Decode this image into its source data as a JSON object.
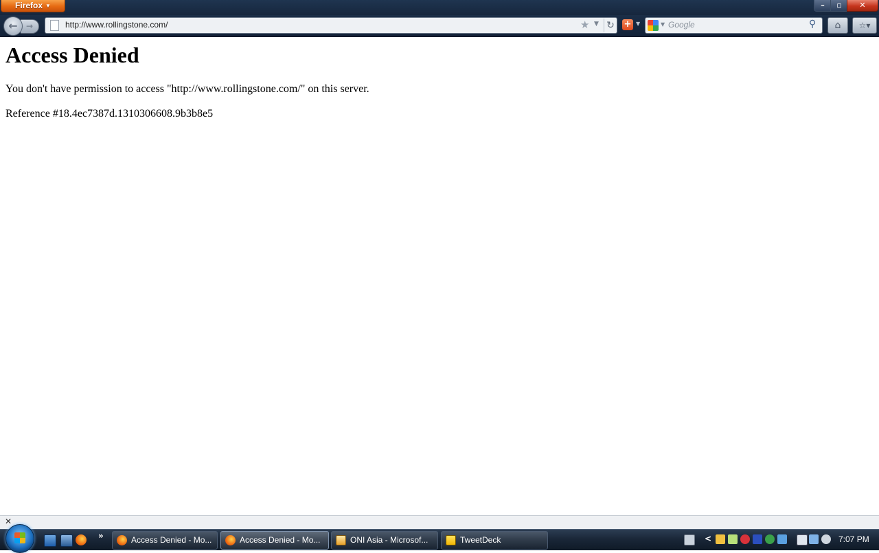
{
  "browser": {
    "menu_label": "Firefox",
    "url": "http://www.rollingstone.com/",
    "search_placeholder": "Google"
  },
  "page": {
    "heading": "Access Denied",
    "message": "You don't have permission to access \"http://www.rollingstone.com/\" on this server.",
    "reference": "Reference #18.4ec7387d.1310306608.9b3b8e5"
  },
  "taskbar": {
    "tasks": [
      {
        "label": "Access Denied - Mo...",
        "icon": "firefox-icon",
        "active": false
      },
      {
        "label": "Access Denied - Mo...",
        "icon": "firefox-icon",
        "active": true
      },
      {
        "label": "ONI Asia - Microsof...",
        "icon": "outlook-icon",
        "active": false
      },
      {
        "label": "TweetDeck",
        "icon": "tweetdeck-icon",
        "active": false
      }
    ],
    "clock": "7:07 PM"
  },
  "colors": {
    "firefox_orange": "#e66a12",
    "chrome_dark": "#16263d",
    "taskbar": "#1a2738"
  }
}
